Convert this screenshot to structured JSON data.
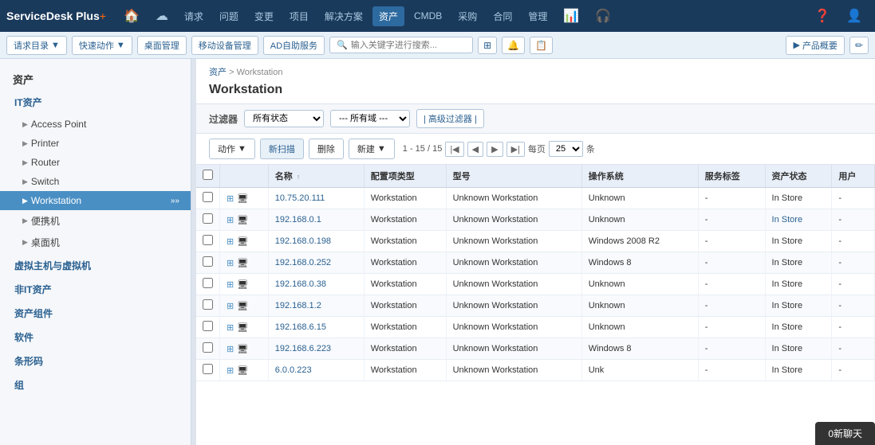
{
  "brand": {
    "name": "ServiceDesk Plus",
    "plus": "+"
  },
  "nav": {
    "home_icon": "🏠",
    "items": [
      {
        "label": "请求",
        "active": false
      },
      {
        "label": "问题",
        "active": false
      },
      {
        "label": "变更",
        "active": false
      },
      {
        "label": "项目",
        "active": false
      },
      {
        "label": "解决方案",
        "active": false
      },
      {
        "label": "资产",
        "active": true
      },
      {
        "label": "CMDB",
        "active": false
      },
      {
        "label": "采购",
        "active": false
      },
      {
        "label": "合同",
        "active": false
      },
      {
        "label": "管理",
        "active": false
      }
    ]
  },
  "toolbar": {
    "request_menu": "请求目录",
    "quick_action": "快速动作",
    "desktop_mgmt": "桌面管理",
    "mobile_mgmt": "移动设备管理",
    "ad_service": "AD自助服务",
    "search_placeholder": "输入关键字进行搜索...",
    "product_overview": "产品概要"
  },
  "breadcrumb": {
    "root": "资产",
    "separator": ">",
    "current": "Workstation"
  },
  "page_title": "Workstation",
  "filter": {
    "label": "过滤器",
    "status_options": [
      "所有状态"
    ],
    "status_selected": "所有状态",
    "domain_options": [
      "--- 所有域 ---"
    ],
    "domain_selected": "--- 所有域 ---",
    "advanced": "| 高级过滤器 |"
  },
  "actions": {
    "action_btn": "动作",
    "new_scan": "新扫描",
    "delete": "删除",
    "new": "新建",
    "pagination_info": "1 - 15 / 15",
    "per_page": "25",
    "per_page_label": "条",
    "every_page": "每页"
  },
  "table": {
    "columns": [
      "",
      "",
      "名称",
      "配置项类型",
      "型号",
      "操作系统",
      "服务标签",
      "资产状态",
      "用户"
    ],
    "rows": [
      {
        "name": "10.75.20.111",
        "config_type": "Workstation",
        "model": "Unknown Workstation",
        "os": "Unknown",
        "service_tag": "-",
        "asset_status": "In Store",
        "asset_status_blue": false,
        "user": "-"
      },
      {
        "name": "192.168.0.1",
        "config_type": "Workstation",
        "model": "Unknown Workstation",
        "os": "Unknown",
        "service_tag": "-",
        "asset_status": "In Store",
        "asset_status_blue": true,
        "user": "-"
      },
      {
        "name": "192.168.0.198",
        "config_type": "Workstation",
        "model": "Unknown Workstation",
        "os": "Windows 2008 R2",
        "service_tag": "-",
        "asset_status": "In Store",
        "asset_status_blue": false,
        "user": "-"
      },
      {
        "name": "192.168.0.252",
        "config_type": "Workstation",
        "model": "Unknown Workstation",
        "os": "Windows 8",
        "service_tag": "-",
        "asset_status": "In Store",
        "asset_status_blue": false,
        "user": "-"
      },
      {
        "name": "192.168.0.38",
        "config_type": "Workstation",
        "model": "Unknown Workstation",
        "os": "Unknown",
        "service_tag": "-",
        "asset_status": "In Store",
        "asset_status_blue": false,
        "user": "-"
      },
      {
        "name": "192.168.1.2",
        "config_type": "Workstation",
        "model": "Unknown Workstation",
        "os": "Unknown",
        "service_tag": "-",
        "asset_status": "In Store",
        "asset_status_blue": false,
        "user": "-"
      },
      {
        "name": "192.168.6.15",
        "config_type": "Workstation",
        "model": "Unknown Workstation",
        "os": "Unknown",
        "service_tag": "-",
        "asset_status": "In Store",
        "asset_status_blue": false,
        "user": "-"
      },
      {
        "name": "192.168.6.223",
        "config_type": "Workstation",
        "model": "Unknown Workstation",
        "os": "Windows 8",
        "service_tag": "-",
        "asset_status": "In Store",
        "asset_status_blue": false,
        "user": "-"
      },
      {
        "name": "6.0.0.223",
        "config_type": "Workstation",
        "model": "Unknown Workstation",
        "os": "Unk",
        "service_tag": "-",
        "asset_status": "In Store",
        "asset_status_blue": false,
        "user": "-"
      }
    ]
  },
  "sidebar": {
    "title": "资产",
    "it_assets": "IT资产",
    "items": [
      {
        "label": "Access Point",
        "active": false
      },
      {
        "label": "Printer",
        "active": false
      },
      {
        "label": "Router",
        "active": false
      },
      {
        "label": "Switch",
        "active": false
      },
      {
        "label": "Workstation",
        "active": true
      },
      {
        "label": "便携机",
        "active": false
      },
      {
        "label": "桌面机",
        "active": false
      }
    ],
    "categories": [
      {
        "label": "虚拟主机与虚拟机",
        "active": false
      },
      {
        "label": "非IT资产",
        "active": false
      },
      {
        "label": "资产组件",
        "active": false
      },
      {
        "label": "软件",
        "active": false
      },
      {
        "label": "条形码",
        "active": false
      },
      {
        "label": "组",
        "active": false
      }
    ]
  },
  "chat": {
    "label": "0新聊天"
  }
}
